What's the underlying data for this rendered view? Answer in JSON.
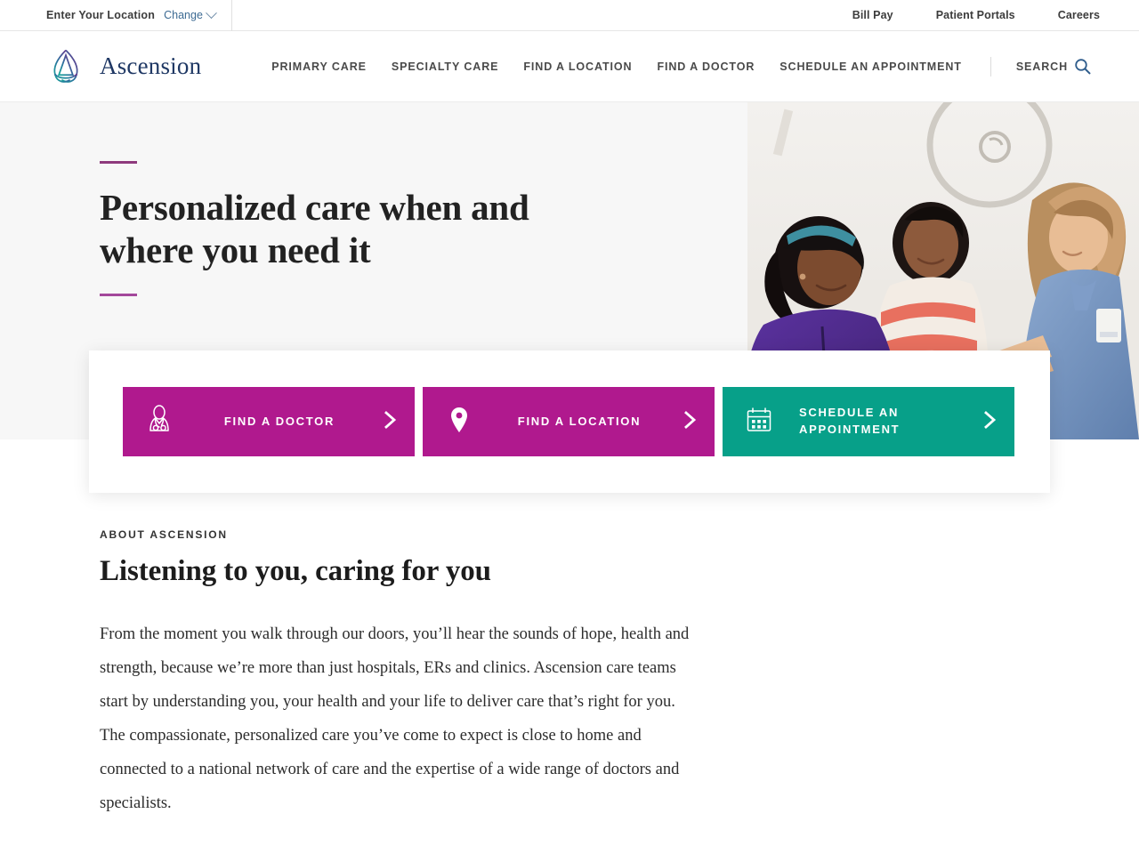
{
  "utility": {
    "location_label": "Enter Your Location",
    "change_label": "Change",
    "links": [
      {
        "label": "Bill Pay",
        "name": "bill-pay"
      },
      {
        "label": "Patient Portals",
        "name": "patient-portals"
      },
      {
        "label": "Careers",
        "name": "careers"
      }
    ]
  },
  "header": {
    "brand_name": "Ascension",
    "nav": [
      {
        "label": "PRIMARY CARE",
        "name": "primary-care"
      },
      {
        "label": "SPECIALTY CARE",
        "name": "specialty-care"
      },
      {
        "label": "FIND A LOCATION",
        "name": "find-a-location"
      },
      {
        "label": "FIND A DOCTOR",
        "name": "find-a-doctor"
      },
      {
        "label": "SCHEDULE AN APPOINTMENT",
        "name": "schedule-an-appointment"
      }
    ],
    "search_label": "SEARCH"
  },
  "hero": {
    "title": "Personalized care when and where you need it"
  },
  "cta": {
    "buttons": [
      {
        "label": "FIND A DOCTOR",
        "icon": "doctor-icon",
        "color": "#b0198e"
      },
      {
        "label": "FIND A LOCATION",
        "icon": "map-pin-icon",
        "color": "#b0198e"
      },
      {
        "label": "SCHEDULE AN APPOINTMENT",
        "icon": "calendar-icon",
        "color": "#07a089"
      }
    ]
  },
  "about": {
    "eyebrow": "ABOUT ASCENSION",
    "title": "Listening to you, caring for you",
    "body": "From the moment you walk through our doors, you’ll hear the sounds of hope, health and strength, because we’re more than just hospitals, ERs and clinics. Ascension care teams start by understanding you, your health and your life to deliver care that’s right for you. The compassionate, personalized care you’ve come to expect is close to home and connected to a national network of care and the expertise of a wide range of doctors and specialists."
  },
  "colors": {
    "magenta": "#b0198e",
    "teal": "#07a089",
    "brand_navy": "#1f3864",
    "link_blue": "#2f5d8c",
    "accent_purple": "#8e3a7d",
    "hero_bg": "#f7f7f7"
  }
}
